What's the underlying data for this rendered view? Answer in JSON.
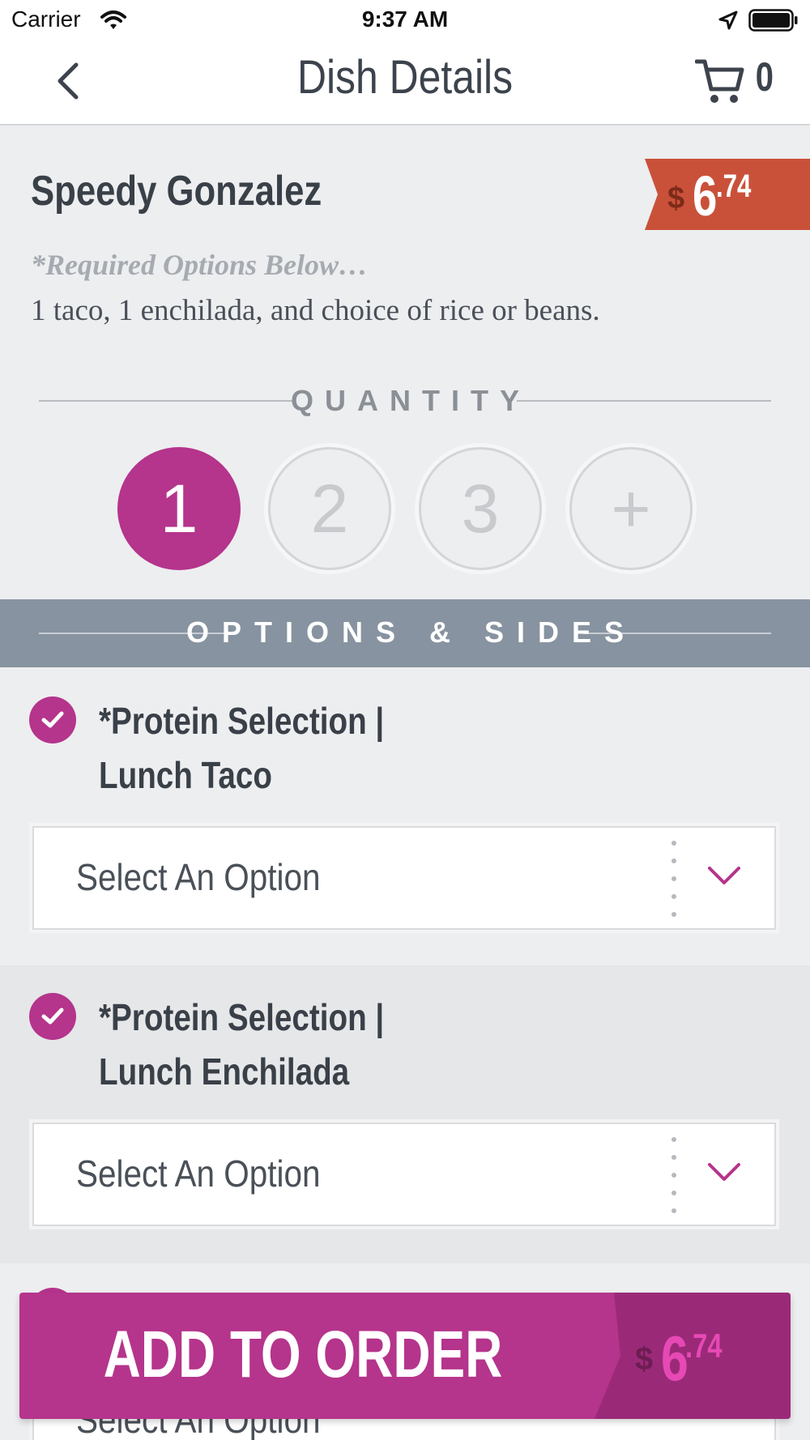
{
  "status_bar": {
    "carrier": "Carrier",
    "time": "9:37 AM",
    "icons": [
      "wifi-icon",
      "location-arrow-icon",
      "battery-icon"
    ]
  },
  "nav": {
    "back_icon": "chevron-left-icon",
    "title": "Dish Details",
    "cart_icon": "cart-icon",
    "cart_count": "0"
  },
  "dish": {
    "name": "Speedy Gonzalez",
    "price": {
      "currency": "$",
      "dollars": "6",
      "cents": ".74"
    },
    "required_note": "*Required Options Below…",
    "description": "1 taco, 1 enchilada, and choice of rice or beans."
  },
  "quantity": {
    "label": "QUANTITY",
    "options": [
      "1",
      "2",
      "3",
      "+"
    ],
    "selected": "1"
  },
  "options_section": {
    "label": "OPTIONS & SIDES",
    "groups": [
      {
        "title_line1": "*Protein Selection |",
        "title_line2": "Lunch Taco",
        "select_value": "Select An Option",
        "checked": true
      },
      {
        "title_line1": "*Protein Selection |",
        "title_line2": "Lunch Enchilada",
        "select_value": "Select An Option",
        "checked": true
      },
      {
        "select_value": "Select An Option",
        "checked": true
      }
    ]
  },
  "add_button": {
    "label": "ADD TO ORDER",
    "price": {
      "currency": "$",
      "dollars": "6",
      "cents": ".74"
    }
  },
  "colors": {
    "accent": "#b5348c",
    "price_tag": "#c9513a",
    "options_band": "#8793a0",
    "background": "#edeef0"
  }
}
